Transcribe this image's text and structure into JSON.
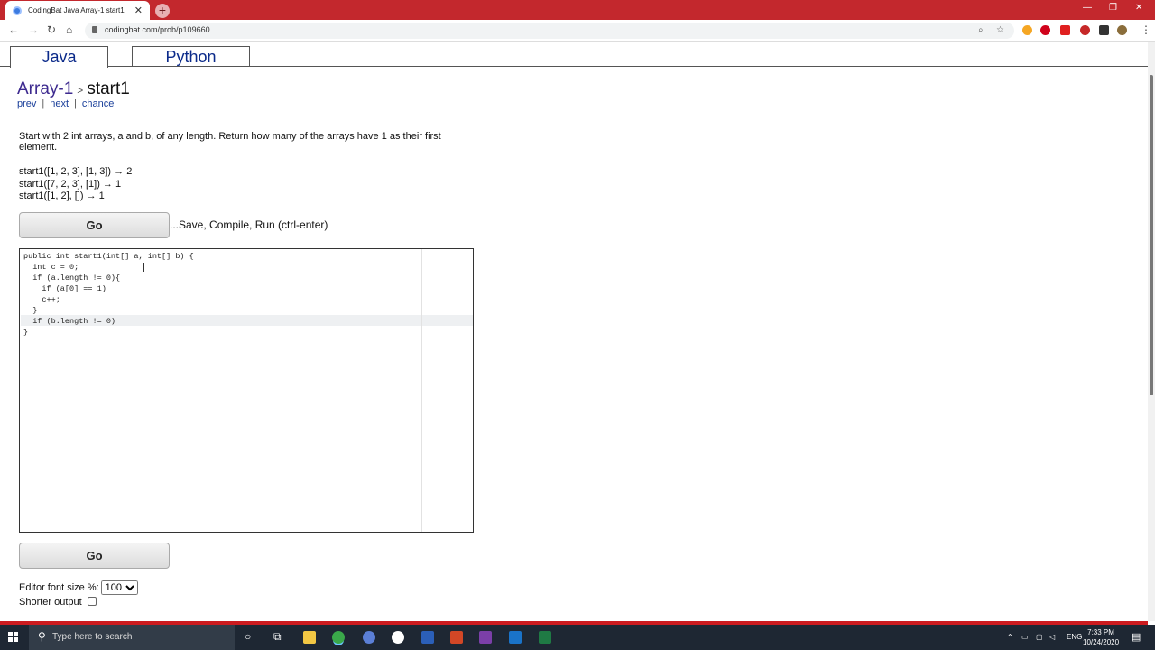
{
  "browser": {
    "tab_title": "CodingBat Java Array-1 start1",
    "tab_close": "✕",
    "new_tab": "+",
    "url": "codingbat.com/prob/p109660",
    "window_controls": [
      "—",
      "❐",
      "✕"
    ]
  },
  "lang_tabs": [
    "Java",
    "Python"
  ],
  "breadcrumb": {
    "group": "Array-1",
    "separator": ">",
    "current": "start1"
  },
  "nav_links": {
    "prev": "prev",
    "next": "next",
    "chance": "chance",
    "sep": "|"
  },
  "problem": {
    "description": "Start with 2 int arrays, a and b, of any length. Return how many of the arrays have 1 as their first element.",
    "examples": [
      "start1([1, 2, 3], [1, 3]) → 2",
      "start1([7, 2, 3], [1]) → 1",
      "start1([1, 2], []) → 1"
    ]
  },
  "go": {
    "label": "Go",
    "hint": "...Save, Compile, Run (ctrl-enter)"
  },
  "editor": {
    "code": "public int start1(int[] a, int[] b) {\n  int c = 0;\n  if (a.length != 0){\n    if (a[0] == 1)\n    c++;\n  }\n  if (b.length != 0)\n}"
  },
  "settings": {
    "font_size_label": "Editor font size %:",
    "font_size_value": "100",
    "shorter_output_label": "Shorter output"
  },
  "taskbar": {
    "search_placeholder": "Type here to search",
    "lang": "ENG",
    "time": "7:33 PM",
    "date": "10/24/2020"
  },
  "colors": {
    "titlebar": "#c3282d",
    "link": "#1a3f9a",
    "accent_red": "#cc1b1f",
    "taskbar": "#1e2733"
  }
}
